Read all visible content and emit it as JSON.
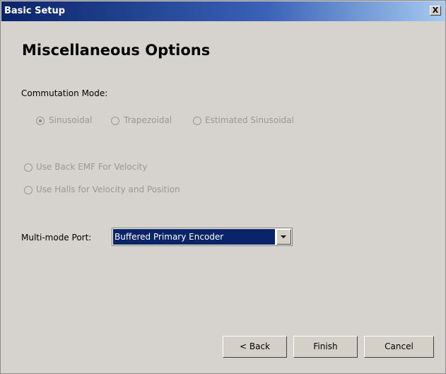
{
  "window": {
    "title": "Basic Setup",
    "close_label": "X"
  },
  "page": {
    "heading": "Miscellaneous Options"
  },
  "commutation": {
    "label": "Commutation Mode:",
    "options": [
      {
        "label": "Sinusoidal",
        "selected": true,
        "enabled": false
      },
      {
        "label": "Trapezoidal",
        "selected": false,
        "enabled": false
      },
      {
        "label": "Estimated Sinusoidal",
        "selected": false,
        "enabled": false
      }
    ]
  },
  "velocity": {
    "options": [
      {
        "label": "Use Back EMF For Velocity",
        "selected": false,
        "enabled": false
      },
      {
        "label": "Use Halls for Velocity and Position",
        "selected": false,
        "enabled": false
      }
    ]
  },
  "multimode": {
    "label": "Multi-mode Port:",
    "selected_value": "Buffered Primary Encoder"
  },
  "buttons": {
    "back": "< Back",
    "finish": "Finish",
    "cancel": "Cancel"
  },
  "colors": {
    "titlebar_start": "#0a246a",
    "titlebar_end": "#a6caf0",
    "dialog_bg": "#d6d3ce",
    "disabled_text": "#9a9891",
    "selection_bg": "#0a246a"
  }
}
